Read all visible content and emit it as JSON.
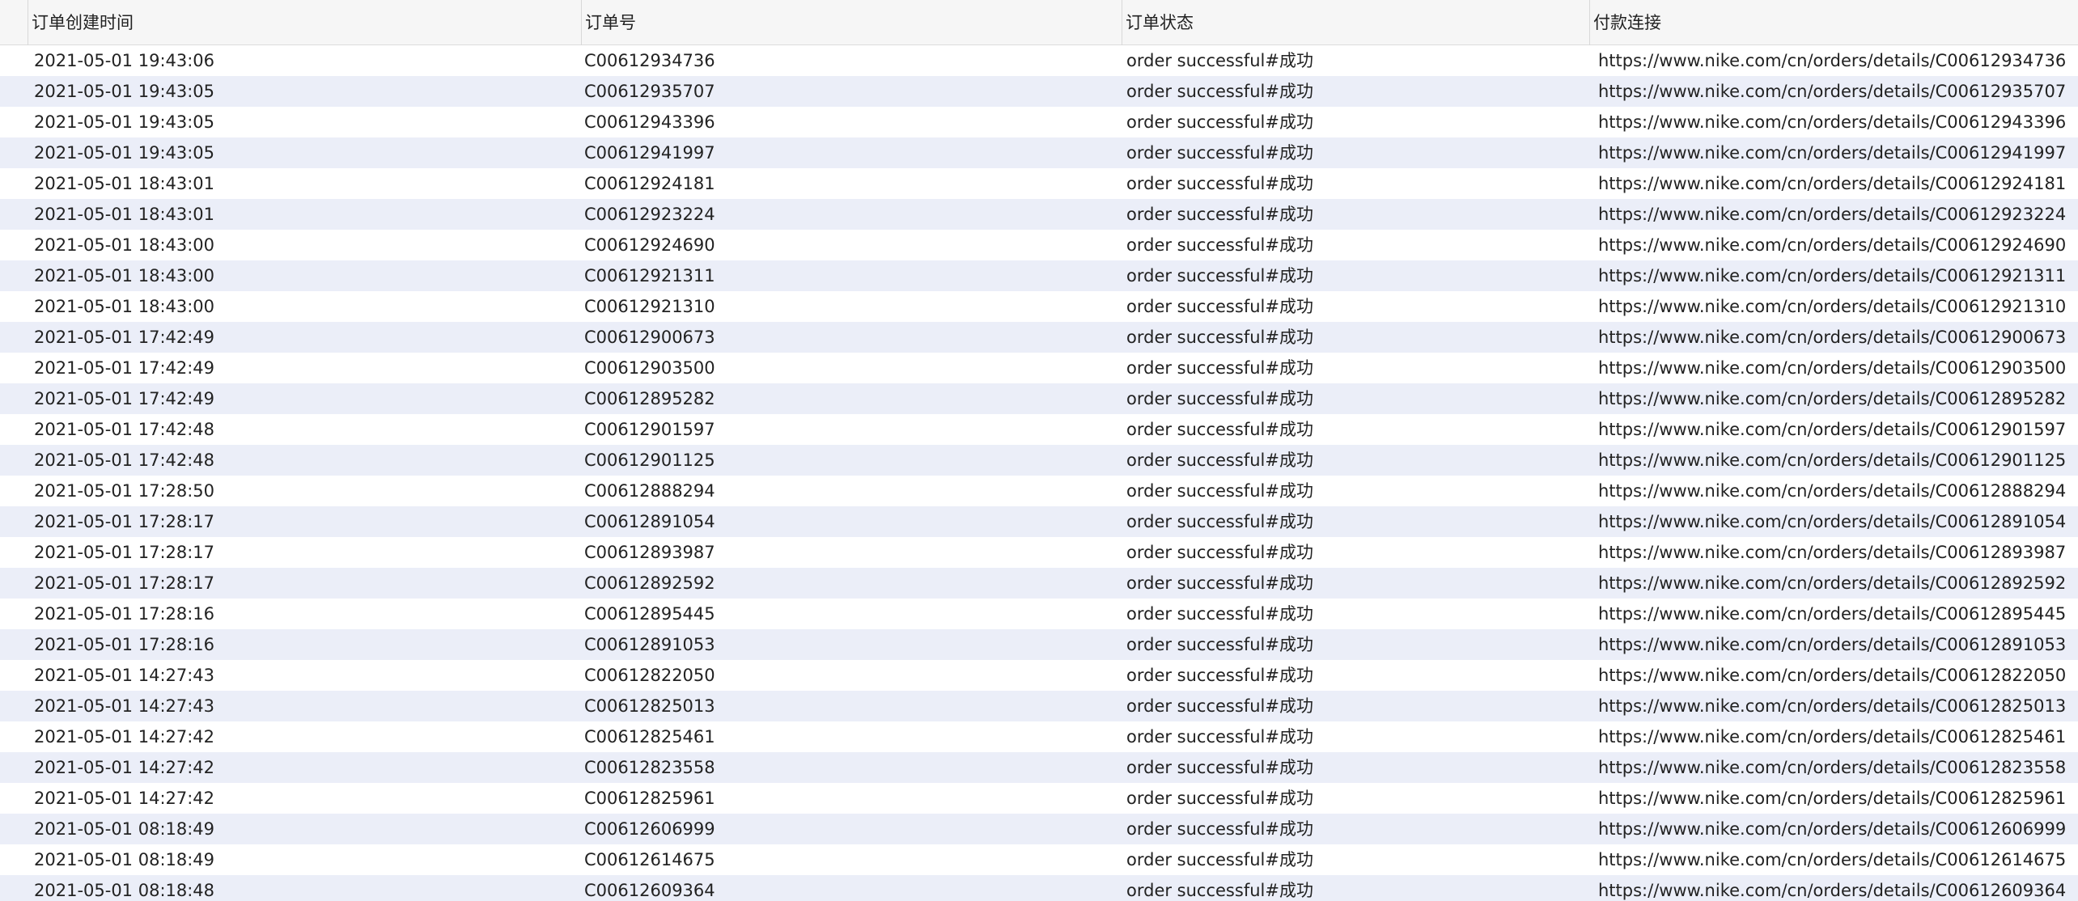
{
  "columns": [
    "订单创建时间",
    "订单号",
    "订单状态",
    "付款连接"
  ],
  "rows": [
    [
      "2021-05-01 19:43:06",
      "C00612934736",
      "order successful#成功",
      "https://www.nike.com/cn/orders/details/C00612934736"
    ],
    [
      "2021-05-01 19:43:05",
      "C00612935707",
      "order successful#成功",
      "https://www.nike.com/cn/orders/details/C00612935707"
    ],
    [
      "2021-05-01 19:43:05",
      "C00612943396",
      "order successful#成功",
      "https://www.nike.com/cn/orders/details/C00612943396"
    ],
    [
      "2021-05-01 19:43:05",
      "C00612941997",
      "order successful#成功",
      "https://www.nike.com/cn/orders/details/C00612941997"
    ],
    [
      "2021-05-01 18:43:01",
      "C00612924181",
      "order successful#成功",
      "https://www.nike.com/cn/orders/details/C00612924181"
    ],
    [
      "2021-05-01 18:43:01",
      "C00612923224",
      "order successful#成功",
      "https://www.nike.com/cn/orders/details/C00612923224"
    ],
    [
      "2021-05-01 18:43:00",
      "C00612924690",
      "order successful#成功",
      "https://www.nike.com/cn/orders/details/C00612924690"
    ],
    [
      "2021-05-01 18:43:00",
      "C00612921311",
      "order successful#成功",
      "https://www.nike.com/cn/orders/details/C00612921311"
    ],
    [
      "2021-05-01 18:43:00",
      "C00612921310",
      "order successful#成功",
      "https://www.nike.com/cn/orders/details/C00612921310"
    ],
    [
      "2021-05-01 17:42:49",
      "C00612900673",
      "order successful#成功",
      "https://www.nike.com/cn/orders/details/C00612900673"
    ],
    [
      "2021-05-01 17:42:49",
      "C00612903500",
      "order successful#成功",
      "https://www.nike.com/cn/orders/details/C00612903500"
    ],
    [
      "2021-05-01 17:42:49",
      "C00612895282",
      "order successful#成功",
      "https://www.nike.com/cn/orders/details/C00612895282"
    ],
    [
      "2021-05-01 17:42:48",
      "C00612901597",
      "order successful#成功",
      "https://www.nike.com/cn/orders/details/C00612901597"
    ],
    [
      "2021-05-01 17:42:48",
      "C00612901125",
      "order successful#成功",
      "https://www.nike.com/cn/orders/details/C00612901125"
    ],
    [
      "2021-05-01 17:28:50",
      "C00612888294",
      "order successful#成功",
      "https://www.nike.com/cn/orders/details/C00612888294"
    ],
    [
      "2021-05-01 17:28:17",
      "C00612891054",
      "order successful#成功",
      "https://www.nike.com/cn/orders/details/C00612891054"
    ],
    [
      "2021-05-01 17:28:17",
      "C00612893987",
      "order successful#成功",
      "https://www.nike.com/cn/orders/details/C00612893987"
    ],
    [
      "2021-05-01 17:28:17",
      "C00612892592",
      "order successful#成功",
      "https://www.nike.com/cn/orders/details/C00612892592"
    ],
    [
      "2021-05-01 17:28:16",
      "C00612895445",
      "order successful#成功",
      "https://www.nike.com/cn/orders/details/C00612895445"
    ],
    [
      "2021-05-01 17:28:16",
      "C00612891053",
      "order successful#成功",
      "https://www.nike.com/cn/orders/details/C00612891053"
    ],
    [
      "2021-05-01 14:27:43",
      "C00612822050",
      "order successful#成功",
      "https://www.nike.com/cn/orders/details/C00612822050"
    ],
    [
      "2021-05-01 14:27:43",
      "C00612825013",
      "order successful#成功",
      "https://www.nike.com/cn/orders/details/C00612825013"
    ],
    [
      "2021-05-01 14:27:42",
      "C00612825461",
      "order successful#成功",
      "https://www.nike.com/cn/orders/details/C00612825461"
    ],
    [
      "2021-05-01 14:27:42",
      "C00612823558",
      "order successful#成功",
      "https://www.nike.com/cn/orders/details/C00612823558"
    ],
    [
      "2021-05-01 14:27:42",
      "C00612825961",
      "order successful#成功",
      "https://www.nike.com/cn/orders/details/C00612825961"
    ],
    [
      "2021-05-01 08:18:49",
      "C00612606999",
      "order successful#成功",
      "https://www.nike.com/cn/orders/details/C00612606999"
    ],
    [
      "2021-05-01 08:18:49",
      "C00612614675",
      "order successful#成功",
      "https://www.nike.com/cn/orders/details/C00612614675"
    ],
    [
      "2021-05-01 08:18:48",
      "C00612609364",
      "order successful#成功",
      "https://www.nike.com/cn/orders/details/C00612609364"
    ]
  ]
}
